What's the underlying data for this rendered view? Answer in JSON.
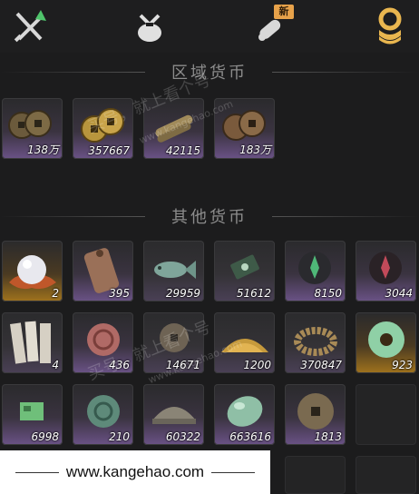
{
  "tabs": [
    {
      "name": "swords",
      "icon": "crossed-swords-icon"
    },
    {
      "name": "bag",
      "icon": "pouch-icon"
    },
    {
      "name": "scroll",
      "icon": "scroll-icon",
      "badge": "新"
    },
    {
      "name": "currency",
      "icon": "coin-stack-icon",
      "active": true
    }
  ],
  "sections": {
    "regional": "区域货币",
    "other": "其他货币"
  },
  "regional_items": [
    {
      "icon": "copper-coins-icon",
      "count": "138万"
    },
    {
      "icon": "gold-coins-icon",
      "count": "357667"
    },
    {
      "icon": "silver-coins-icon",
      "count": "42115"
    },
    {
      "icon": "bronze-coins-icon",
      "count": "183万"
    }
  ],
  "other_items": [
    {
      "icon": "pearl-icon",
      "count": "2"
    },
    {
      "icon": "token-plate-icon",
      "count": "395"
    },
    {
      "icon": "jade-fish-icon",
      "count": "29959"
    },
    {
      "icon": "jade-tablet-icon",
      "count": "51612"
    },
    {
      "icon": "green-rune-icon",
      "count": "8150"
    },
    {
      "icon": "red-rune-icon",
      "count": "3044"
    },
    {
      "icon": "paper-notes-icon",
      "count": "4"
    },
    {
      "icon": "red-coin-icon",
      "count": "436"
    },
    {
      "icon": "bronze-coin-icon",
      "count": "14671"
    },
    {
      "icon": "grain-pile-icon",
      "count": "1200"
    },
    {
      "icon": "coin-string-icon",
      "count": "370847"
    },
    {
      "icon": "jade-ring-icon",
      "count": "923"
    },
    {
      "icon": "green-map-icon",
      "count": "6998"
    },
    {
      "icon": "teal-coin-icon",
      "count": "210"
    },
    {
      "icon": "silver-ingot-icon",
      "count": "60322"
    },
    {
      "icon": "jade-stone-icon",
      "count": "663616"
    },
    {
      "icon": "square-hole-coin-icon",
      "count": "1813"
    }
  ],
  "watermarks": {
    "main": "买号，就上看个号",
    "url": "www.kangehao.com",
    "small": "看个号"
  },
  "footer": {
    "url": "www.kangehao.com"
  },
  "colors": {
    "background": "#1c1c1d",
    "badge": "#e7a24a",
    "active_icon": "#e9b64f",
    "purple_glow": "#6a5286",
    "gold_glow": "#a0731d"
  }
}
